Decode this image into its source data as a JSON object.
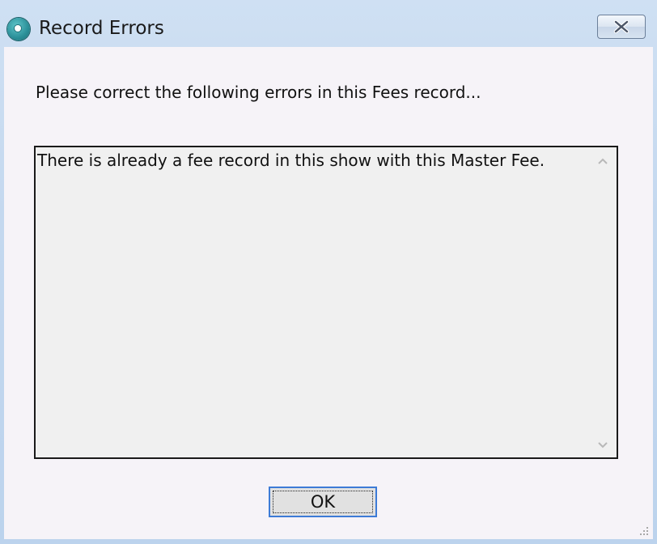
{
  "window": {
    "title": "Record Errors",
    "app_icon": "app-icon",
    "close_icon": "close-x-icon"
  },
  "dialog": {
    "prompt": "Please correct the following errors in this Fees record...",
    "errors_text": "There is already a fee record in this show with this Master Fee.",
    "ok_label": "OK"
  },
  "colors": {
    "accent_focus": "#3d7bd6",
    "client_background": "#f6f3f8",
    "text_area_background": "#f0f0f0"
  }
}
